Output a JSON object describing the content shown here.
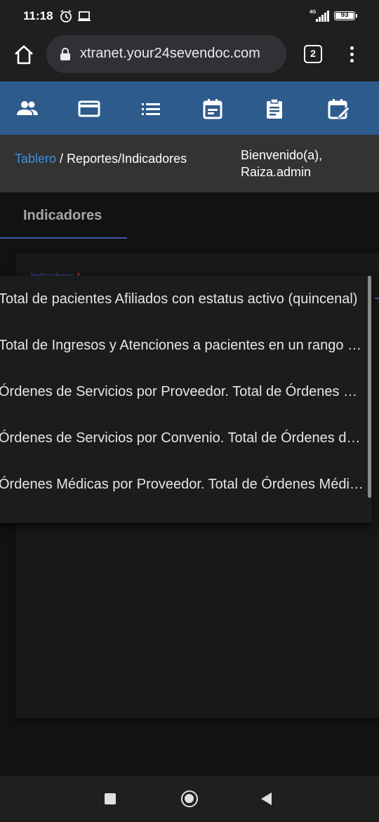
{
  "status_bar": {
    "time": "11:18",
    "network": "4G",
    "battery": "93",
    "battery_level": 0.93
  },
  "browser": {
    "url": "xtranet.your24sevendoc.com",
    "tab_count": "2",
    "icons": [
      "home-icon",
      "lock-icon",
      "tabs-icon",
      "menu-icon"
    ]
  },
  "nav": {
    "icons": [
      "users-icon",
      "credit-card-icon",
      "list-icon",
      "calendar-icon",
      "clipboard-icon",
      "calendar-edit-icon"
    ],
    "background": "#2d5b8c"
  },
  "breadcrumb": {
    "link": "Tablero",
    "separator": " / ",
    "current": "Reportes/Indicadores"
  },
  "welcome": {
    "line1": "Bienvenido(a),",
    "line2": "Raiza.admin"
  },
  "tabs": [
    {
      "label": "Indicadores",
      "active": true
    }
  ],
  "form": {
    "field_label": "Indicadores",
    "required_mark": "*"
  },
  "dropdown": {
    "options": [
      "Total de pacientes Afiliados con estatus activo (quincenal)",
      "Total de Ingresos y Atenciones a pacientes en un rango de fechas",
      "Órdenes de Servicios por Proveedor. Total de Órdenes de Servicios",
      "Órdenes de Servicios por Convenio. Total de Órdenes de Servicios",
      "Órdenes Médicas por Proveedor. Total de Órdenes Médicas"
    ]
  },
  "system_nav": [
    "recents-icon",
    "home-circle-icon",
    "back-icon"
  ],
  "colors": {
    "link": "#3d8fe0",
    "accent": "#3d5ab0",
    "required": "#e53935"
  }
}
